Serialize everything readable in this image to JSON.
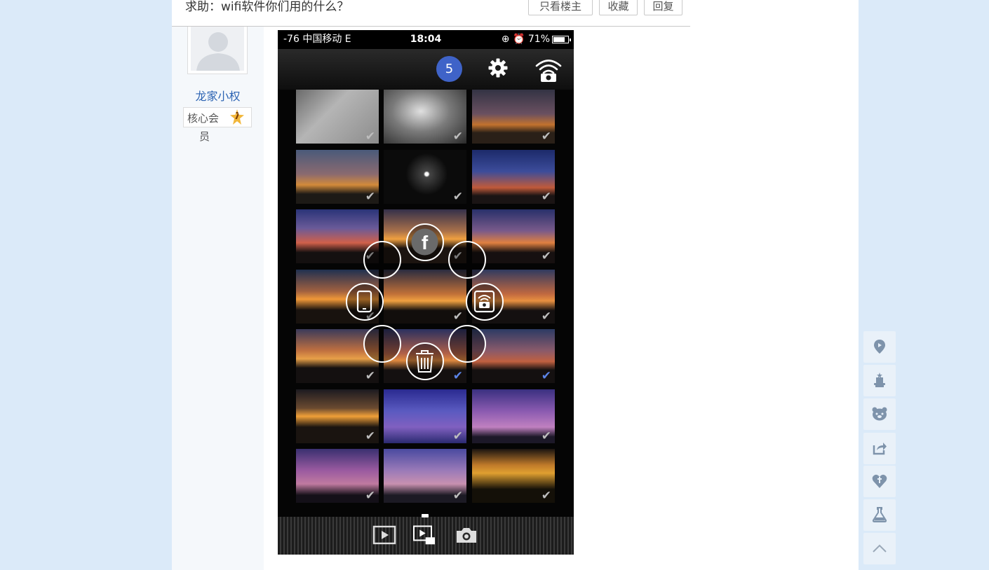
{
  "post": {
    "title": "求助：wifi软件你们用的什么？",
    "buttons": {
      "only_op": "只看楼主",
      "favorite": "收藏",
      "reply": "回复"
    }
  },
  "author": {
    "name": "龙家小权",
    "level_line1": "核心会",
    "level_line2": "员",
    "level_number": "7"
  },
  "phone": {
    "status": {
      "signal": "-76 中国移动  E",
      "time": "18:04",
      "battery": "71%",
      "battery_level": 0.71
    },
    "selected_count": "5"
  },
  "colors": {
    "page_bg": "#dbeaf9",
    "link_blue": "#2d64b3",
    "badge_blue": "#3f63c8",
    "check_selected": "#5b84e8"
  },
  "icons": {
    "toolbar": [
      "gear-icon",
      "wifi-camera-icon"
    ],
    "radial_menu": [
      "facebook-icon",
      "phone-icon",
      "wifi-camera-icon",
      "trash-icon"
    ],
    "bottom_bar": [
      "play-icon",
      "slideshow-icon",
      "camera-icon"
    ],
    "float_bar": [
      "location-pin-icon",
      "magic-hat-icon",
      "bear-icon",
      "share-icon",
      "heart-icon",
      "flask-icon",
      "back-to-top-icon"
    ]
  }
}
